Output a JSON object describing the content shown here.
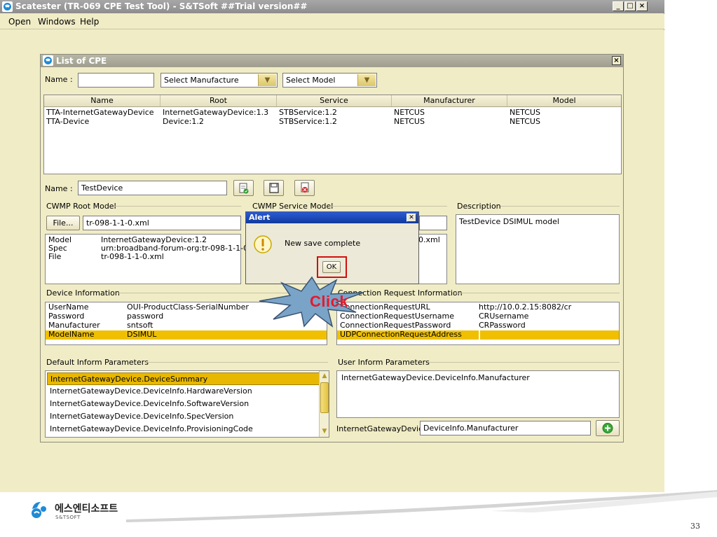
{
  "app": {
    "title": "Scatester (TR-069 CPE Test Tool) - S&TSoft ##Trial version##",
    "menu": [
      "Open",
      "Windows",
      "Help"
    ]
  },
  "frame": {
    "title": "List of CPE",
    "name_label": "Name :",
    "name_filter": "",
    "manufacture_combo": "Select Manufacture",
    "model_combo": "Select Model"
  },
  "cpe_table": {
    "columns": [
      "Name",
      "Root",
      "Service",
      "Manufacturer",
      "Model"
    ],
    "rows": [
      [
        "TTA-InternetGatewayDevice",
        "InternetGatewayDevice:1.3",
        "STBService:1.2",
        "NETCUS",
        "NETCUS"
      ],
      [
        "TTA-Device",
        "Device:1.2",
        "STBService:1.2",
        "NETCUS",
        "NETCUS"
      ]
    ]
  },
  "device_name": {
    "label": "Name :",
    "value": "TestDevice"
  },
  "cwmp_root_model": {
    "title": "CWMP Root Model",
    "file_button": "File...",
    "file_value": "tr-098-1-1-0.xml",
    "rows": [
      {
        "key": "Model",
        "value": "InternetGatewayDevice:1.2"
      },
      {
        "key": "Spec",
        "value": "urn:broadband-forum-org:tr-098-1-1-0"
      },
      {
        "key": "File",
        "value": "tr-098-1-1-0.xml"
      }
    ]
  },
  "cwmp_service_model": {
    "title": "CWMP Service Model",
    "file_fragment": "0.xml"
  },
  "description": {
    "title": "Description",
    "value": "TestDevice DSIMUL model"
  },
  "device_information": {
    "title": "Device Information",
    "rows": [
      {
        "key": "UserName",
        "value": "OUI-ProductClass-SerialNumber"
      },
      {
        "key": "Password",
        "value": "password"
      },
      {
        "key": "Manufacturer",
        "value": "sntsoft"
      },
      {
        "key": "ModelName",
        "value": "DSIMUL"
      }
    ],
    "selected_index": 3
  },
  "connection_request": {
    "title": "Connection Request Information",
    "rows": [
      {
        "key": "ConnectionRequestURL",
        "value": "http://10.0.2.15:8082/cr"
      },
      {
        "key": "ConnectionRequestUsername",
        "value": "CRUsername"
      },
      {
        "key": "ConnectionRequestPassword",
        "value": "CRPassword"
      },
      {
        "key": "UDPConnectionRequestAddress",
        "value": ""
      }
    ],
    "selected_index": 3
  },
  "default_inform": {
    "title": "Default Inform Parameters",
    "items": [
      "InternetGatewayDevice.DeviceSummary",
      "InternetGatewayDevice.DeviceInfo.HardwareVersion",
      "InternetGatewayDevice.DeviceInfo.SoftwareVersion",
      "InternetGatewayDevice.DeviceInfo.SpecVersion",
      "InternetGatewayDevice.DeviceInfo.ProvisioningCode"
    ],
    "selected_index": 0
  },
  "user_inform": {
    "title": "User Inform Parameters",
    "items": [
      "InternetGatewayDevice.DeviceInfo.Manufacturer"
    ],
    "prefix_label": "InternetGatewayDevice.",
    "input_value": "DeviceInfo.Manufacturer"
  },
  "alert": {
    "title": "Alert",
    "message": "New save complete",
    "ok_label": "OK"
  },
  "callout": {
    "text": "Click"
  },
  "footer": {
    "company_korean": "에스엔티소프트",
    "company_english": "S&TSOFT",
    "page_number": "33"
  },
  "colors": {
    "window_bg": "#f0ecc6",
    "selection": "#f0c000",
    "callout_fill": "#7aa3c8",
    "callout_text": "#e8182a",
    "highlight_box": "#d01010"
  }
}
